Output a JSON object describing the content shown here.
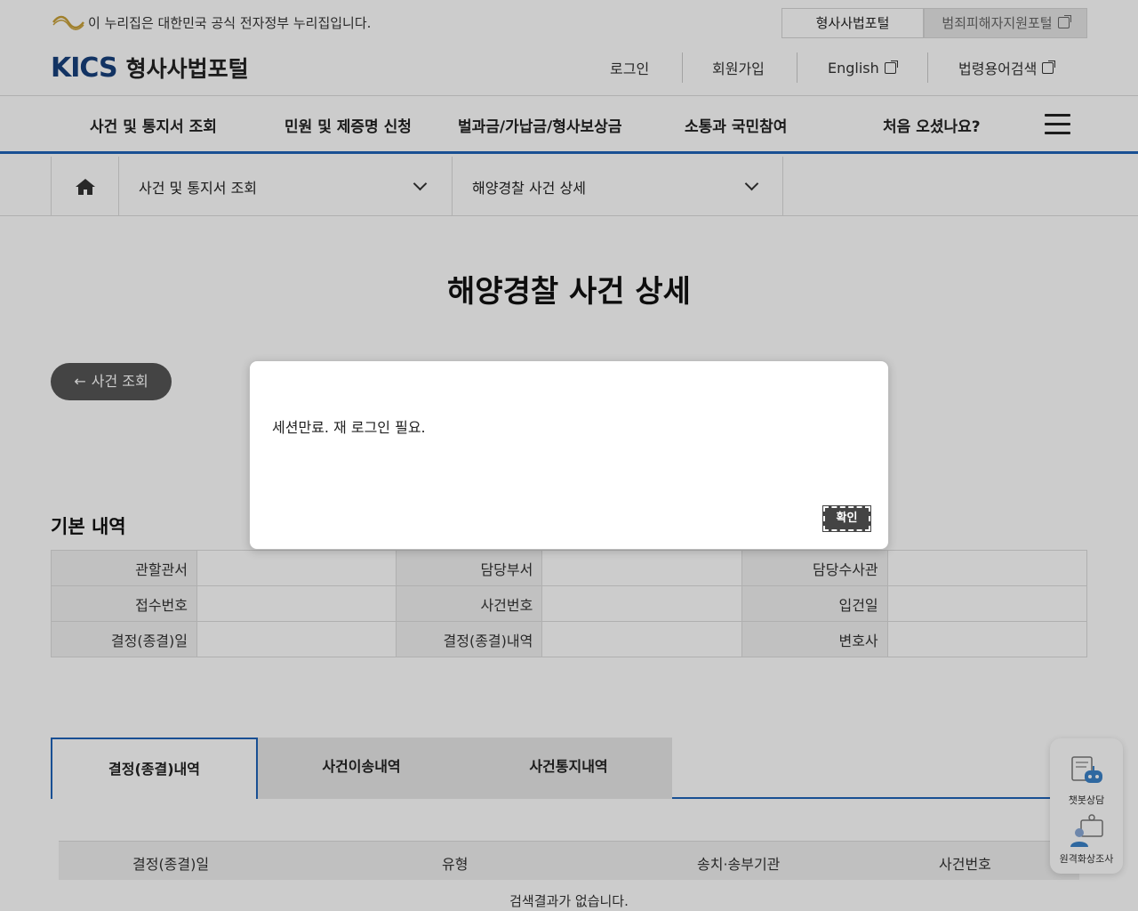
{
  "gov_banner": {
    "text": "이 누리집은 대한민국 공식 전자정부 누리집입니다."
  },
  "portal_tabs": [
    {
      "label": "형사사법포털"
    },
    {
      "label": "범죄피해자지원포털"
    }
  ],
  "brand": {
    "logo": "KICS",
    "name": "형사사법포털"
  },
  "utility_links": [
    {
      "label": "로그인"
    },
    {
      "label": "회원가입"
    },
    {
      "label": "English"
    },
    {
      "label": "법령용어검색"
    }
  ],
  "gnb": [
    {
      "label": "사건 및 통지서 조회"
    },
    {
      "label": "민원 및 제증명 신청"
    },
    {
      "label": "벌과금/가납금/형사보상금"
    },
    {
      "label": "소통과 국민참여"
    },
    {
      "label": "처음 오셨나요?"
    }
  ],
  "location": {
    "depth1": "사건 및 통지서 조회",
    "depth2": "해양경찰 사건 상세"
  },
  "page_title": "해양경찰 사건 상세",
  "back_button": {
    "label": "사건 조회"
  },
  "basic_info": {
    "title": "기본 내역",
    "rows": [
      [
        "관할관서",
        "담당부서",
        "담당수사관"
      ],
      [
        "접수번호",
        "사건번호",
        "입건일"
      ],
      [
        "결정(종결)일",
        "결정(종결)내역",
        "변호사"
      ]
    ]
  },
  "tabs": [
    {
      "label": "결정(종결)내역"
    },
    {
      "label": "사건이송내역"
    },
    {
      "label": "사건통지내역"
    }
  ],
  "list": {
    "columns": [
      "결정(종결)일",
      "유형",
      "송치·송부기관",
      "사건번호"
    ],
    "empty_text": "검색결과가 없습니다."
  },
  "quick_menu": [
    {
      "label": "챗봇상담"
    },
    {
      "label": "원격화상조사"
    }
  ],
  "dialog": {
    "message": "세션만료. 재 로그인 필요.",
    "confirm_label": "확인"
  }
}
